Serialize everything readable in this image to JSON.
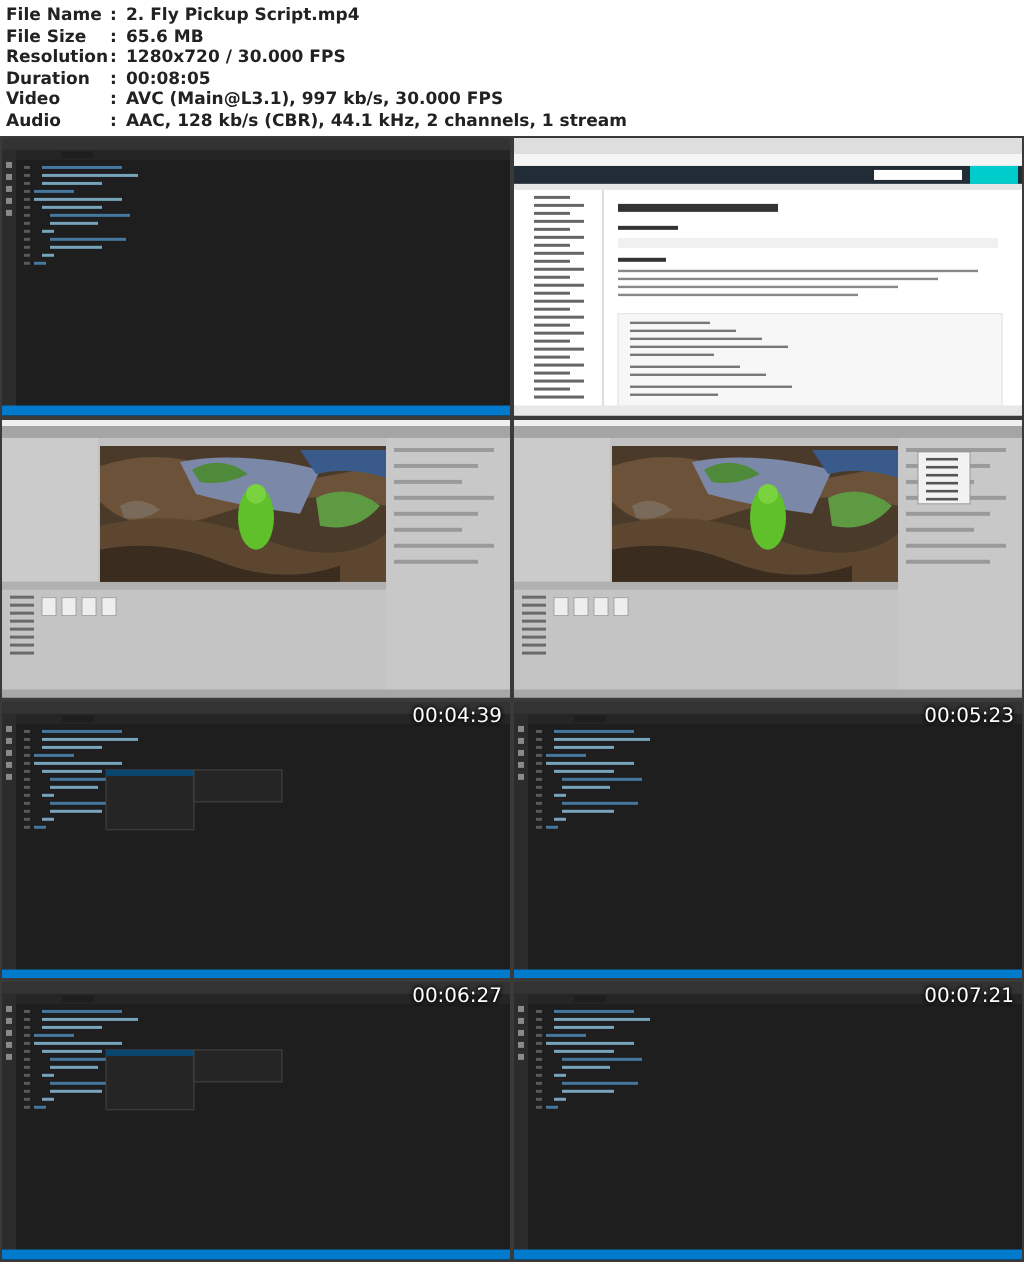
{
  "file_info": [
    {
      "label": "File Name",
      "value": "2. Fly Pickup Script.mp4"
    },
    {
      "label": "File Size",
      "value": "65.6 MB"
    },
    {
      "label": "Resolution",
      "value": "1280x720 / 30.000 FPS"
    },
    {
      "label": "Duration",
      "value": "00:08:05"
    },
    {
      "label": "Video",
      "value": "AVC (Main@L3.1), 997 kb/s, 30.000 FPS"
    },
    {
      "label": "Audio",
      "value": "AAC, 128 kb/s (CBR), 44.1 kHz, 2 channels, 1 stream"
    }
  ],
  "separator": ":",
  "frames": [
    {
      "kind": "code"
    },
    {
      "kind": "browser"
    },
    {
      "kind": "unity"
    },
    {
      "kind": "unity-menu"
    },
    {
      "kind": "code-suggest",
      "timestamp": "00:04:39"
    },
    {
      "kind": "code",
      "timestamp": "00:05:23"
    },
    {
      "kind": "code-suggest",
      "timestamp": "00:06:27"
    },
    {
      "kind": "code",
      "timestamp": "00:07:21"
    }
  ]
}
